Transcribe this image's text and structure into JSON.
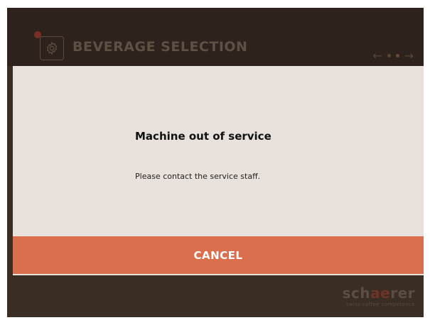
{
  "header": {
    "title": "BEVERAGE SELECTION",
    "settings_icon": "gear-icon",
    "alert_icon": "alert-dot-icon",
    "pager": {
      "back_icon": "arrow-left-icon",
      "forward_icon": "arrow-right-icon",
      "page_count": 2,
      "active_page": 2
    }
  },
  "dialog": {
    "title": "Machine out of service",
    "message": "Please contact the service staff.",
    "cancel_label": "CANCEL"
  },
  "brand": {
    "name_start": "sch",
    "name_accent": "ae",
    "name_end": "rer",
    "tagline": "swiss coffee competence"
  },
  "colors": {
    "screen_bg": "#3a2d24",
    "dialog_bg": "#e8e1dc",
    "cancel_bg": "#d96f4c",
    "cancel_text": "#ffffff"
  }
}
